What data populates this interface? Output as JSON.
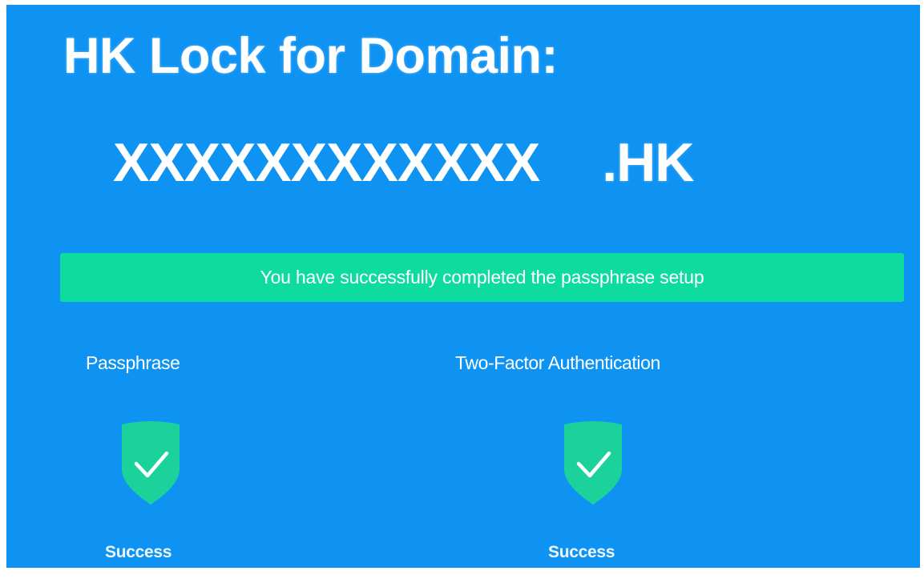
{
  "header": {
    "title": "HK Lock for Domain:",
    "domain_name": "XXXXXXXXXXXX",
    "domain_suffix": ".HK"
  },
  "banner": {
    "message": "You have successfully completed the passphrase setup"
  },
  "sections": [
    {
      "label": "Passphrase",
      "icon": "shield-check-icon",
      "status": "Success"
    },
    {
      "label": "Two-Factor Authentication",
      "icon": "shield-check-icon",
      "status": "Success"
    }
  ],
  "colors": {
    "background": "#0f93f3",
    "banner": "#0edc9f",
    "shield": "#1bd39a",
    "text": "#ffffff"
  }
}
